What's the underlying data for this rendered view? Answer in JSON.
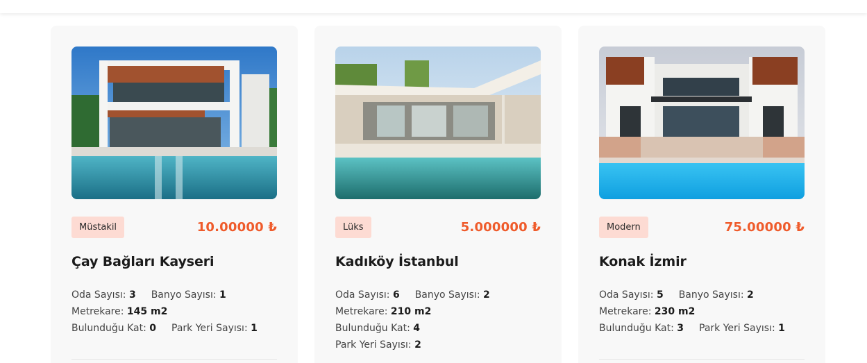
{
  "listings": [
    {
      "category": "Müstakil",
      "price": "10.00000 ₺",
      "title": "Çay Bağları Kayseri",
      "specs": {
        "rooms_label": "Oda Sayısı:",
        "rooms": "3",
        "baths_label": "Banyo Sayısı:",
        "baths": "1",
        "area_label": "Metrekare:",
        "area": "145 m2",
        "floor_label": "Bulunduğu Kat:",
        "floor": "0",
        "parking_label": "Park Yeri Sayısı:",
        "parking": "1"
      }
    },
    {
      "category": "Lüks",
      "price": "5.000000 ₺",
      "title": "Kadıköy İstanbul",
      "specs": {
        "rooms_label": "Oda Sayısı:",
        "rooms": "6",
        "baths_label": "Banyo Sayısı:",
        "baths": "2",
        "area_label": "Metrekare:",
        "area": "210 m2",
        "floor_label": "Bulunduğu Kat:",
        "floor": "4",
        "parking_label": "Park Yeri Sayısı:",
        "parking": "2"
      }
    },
    {
      "category": "Modern",
      "price": "75.00000 ₺",
      "title": "Konak İzmir",
      "specs": {
        "rooms_label": "Oda Sayısı:",
        "rooms": "5",
        "baths_label": "Banyo Sayısı:",
        "baths": "2",
        "area_label": "Metrekare:",
        "area": "230 m2",
        "floor_label": "Bulunduğu Kat:",
        "floor": "3",
        "parking_label": "Park Yeri Sayısı:",
        "parking": "1"
      }
    }
  ],
  "colors": {
    "accent": "#ef5b2b",
    "badge_bg": "#fddbd3",
    "card_bg": "#f8f8f8"
  }
}
